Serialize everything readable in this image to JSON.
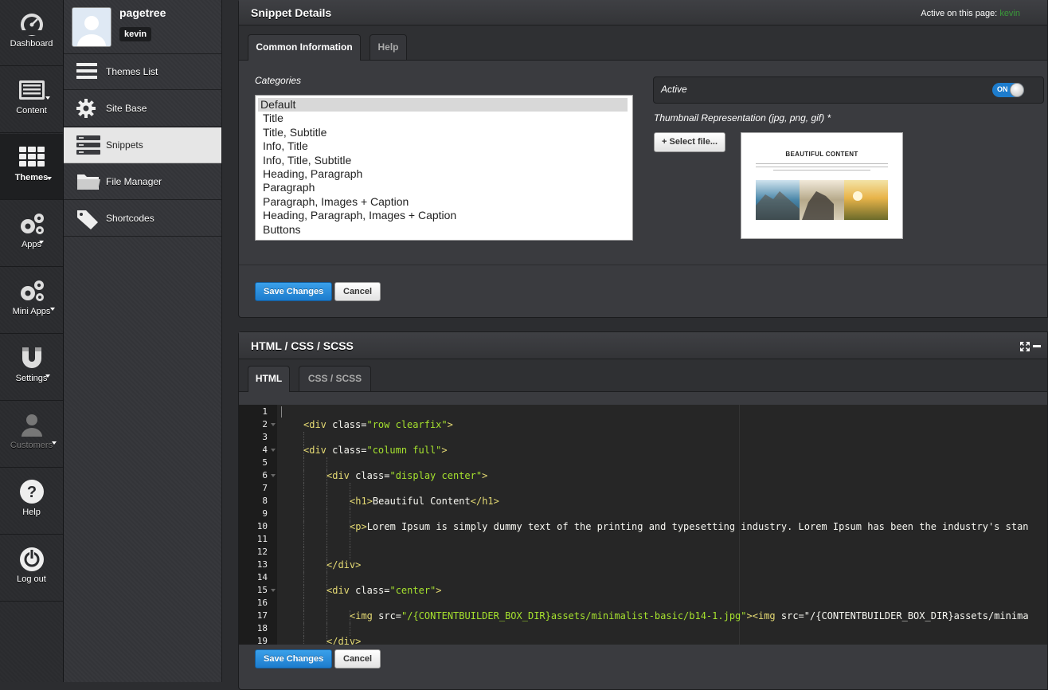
{
  "rail": {
    "items": [
      {
        "label": "Dashboard",
        "icon": "dashboard-icon"
      },
      {
        "label": "Content",
        "icon": "content-icon"
      },
      {
        "label": "Themes",
        "icon": "themes-icon"
      },
      {
        "label": "Apps",
        "icon": "apps-icon"
      },
      {
        "label": "Mini Apps",
        "icon": "mini-apps-icon"
      },
      {
        "label": "Settings",
        "icon": "settings-icon"
      },
      {
        "label": "Customers",
        "icon": "customers-icon"
      },
      {
        "label": "Help",
        "icon": "help-icon"
      },
      {
        "label": "Log out",
        "icon": "logout-icon"
      }
    ]
  },
  "user": {
    "name": "pagetree",
    "badge": "kevin"
  },
  "subnav": {
    "items": [
      {
        "label": "Themes List",
        "icon": "list-icon"
      },
      {
        "label": "Site Base",
        "icon": "gear-icon"
      },
      {
        "label": "Snippets",
        "icon": "server-icon"
      },
      {
        "label": "File Manager",
        "icon": "folder-icon"
      },
      {
        "label": "Shortcodes",
        "icon": "tags-icon"
      }
    ]
  },
  "snippet": {
    "title": "Snippet Details",
    "active_on_page_label": "Active on this page:",
    "active_on_page_value": "kevin",
    "tabs": [
      "Common Information",
      "Help"
    ],
    "categories_label": "Categories",
    "categories": [
      "Default",
      "Title",
      "Title, Subtitle",
      "Info, Title",
      "Info, Title, Subtitle",
      "Heading, Paragraph",
      "Paragraph",
      "Paragraph, Images + Caption",
      "Heading, Paragraph, Images + Caption",
      "Buttons"
    ],
    "selected_category": "Default",
    "active_label": "Active",
    "toggle_state": "ON",
    "thumbnail_label": "Thumbnail Representation (jpg, png, gif) *",
    "select_file_label": "+ Select file...",
    "thumbnail_title": "BEAUTIFUL CONTENT",
    "save_label": "Save Changes",
    "cancel_label": "Cancel"
  },
  "code": {
    "title": "HTML / CSS / SCSS",
    "tabs": [
      "HTML",
      "CSS / SCSS"
    ],
    "lines": [
      {
        "n": "1",
        "fold": false,
        "text": ""
      },
      {
        "n": "2",
        "fold": true,
        "text": "<div class=\"row clearfix\">"
      },
      {
        "n": "3",
        "fold": false,
        "text": ""
      },
      {
        "n": "4",
        "fold": true,
        "text": "<div class=\"column full\">"
      },
      {
        "n": "5",
        "fold": false,
        "text": ""
      },
      {
        "n": "6",
        "fold": true,
        "text": "<div class=\"display center\">"
      },
      {
        "n": "7",
        "fold": false,
        "text": ""
      },
      {
        "n": "8",
        "fold": false,
        "text": "<h1>Beautiful Content</h1>"
      },
      {
        "n": "9",
        "fold": false,
        "text": ""
      },
      {
        "n": "10",
        "fold": false,
        "text": "<p>Lorem Ipsum is simply dummy text of the printing and typesetting industry. Lorem Ipsum has been the industry's stan"
      },
      {
        "n": "11",
        "fold": false,
        "text": ""
      },
      {
        "n": "12",
        "fold": false,
        "text": ""
      },
      {
        "n": "13",
        "fold": false,
        "text": "</div>"
      },
      {
        "n": "14",
        "fold": false,
        "text": ""
      },
      {
        "n": "15",
        "fold": true,
        "text": "<div class=\"center\">"
      },
      {
        "n": "16",
        "fold": false,
        "text": ""
      },
      {
        "n": "17",
        "fold": false,
        "text": "<img src=\"/{CONTENTBUILDER_BOX_DIR}assets/minimalist-basic/b14-1.jpg\"><img src=\"/{CONTENTBUILDER_BOX_DIR}assets/minima"
      },
      {
        "n": "18",
        "fold": false,
        "text": ""
      },
      {
        "n": "19",
        "fold": false,
        "text": "</div>"
      }
    ],
    "save_label": "Save Changes",
    "cancel_label": "Cancel"
  },
  "colors": {
    "accent": "#1d7ccd",
    "active_user": "#3a9a3a",
    "code_string": "#a6e22e",
    "code_tag": "#e6db74"
  }
}
